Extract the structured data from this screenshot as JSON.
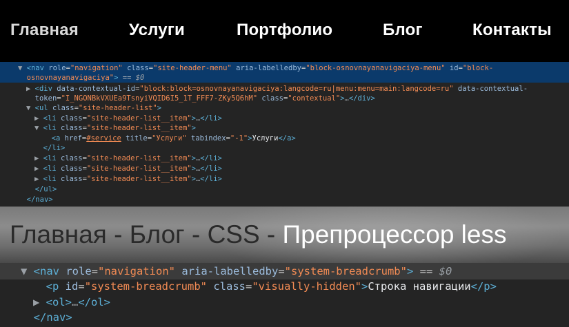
{
  "top_nav": {
    "items": [
      "Главная",
      "Услуги",
      "Портфолио",
      "Блог",
      "Контакты"
    ]
  },
  "devtools_1": {
    "lines": [
      {
        "tri": "▼",
        "parts": [
          [
            "tag",
            "<nav "
          ],
          [
            "attr",
            "role"
          ],
          [
            "eq",
            "="
          ],
          [
            "val",
            "\"navigation\""
          ],
          [
            "attr",
            " class"
          ],
          [
            "eq",
            "="
          ],
          [
            "val",
            "\"site-header-menu\""
          ],
          [
            "attr",
            " aria-labelledby"
          ],
          [
            "eq",
            "="
          ],
          [
            "val",
            "\"block-osnovnayanavigaciya-menu\""
          ],
          [
            "attr",
            " id"
          ],
          [
            "eq",
            "="
          ],
          [
            "val",
            "\"block-"
          ]
        ]
      },
      {
        "tri": "",
        "parts": [
          [
            "val",
            "osnovnayanavigaciya\""
          ],
          [
            "tag",
            ">"
          ],
          [
            "eq",
            " == "
          ],
          [
            "dollar",
            "$0"
          ]
        ]
      },
      {
        "tri": "▶",
        "parts": [
          [
            "tag",
            "<div "
          ],
          [
            "attr",
            "data-contextual-id"
          ],
          [
            "eq",
            "="
          ],
          [
            "val",
            "\"block:block=osnovnayanavigaciya:langcode=ru|menu:menu=main:langcode=ru\""
          ],
          [
            "attr",
            " data-contextual-"
          ]
        ]
      },
      {
        "tri": "",
        "parts": [
          [
            "attr",
            "token"
          ],
          [
            "eq",
            "="
          ],
          [
            "val",
            "\"I_NGONBkVXUEa9TsnyiVQID6I5_1T_FFF7-ZKy5Q6hM\""
          ],
          [
            "attr",
            " class"
          ],
          [
            "eq",
            "="
          ],
          [
            "val",
            "\"contextual\""
          ],
          [
            "tag",
            ">"
          ],
          [
            "dots",
            "…"
          ],
          [
            "tag",
            "</div>"
          ]
        ]
      },
      {
        "tri": "▼",
        "parts": [
          [
            "tag",
            "<ul "
          ],
          [
            "attr",
            "class"
          ],
          [
            "eq",
            "="
          ],
          [
            "val",
            "\"site-header-list\""
          ],
          [
            "tag",
            ">"
          ]
        ]
      },
      {
        "tri": "▶",
        "parts": [
          [
            "tag",
            "<li "
          ],
          [
            "attr",
            "class"
          ],
          [
            "eq",
            "="
          ],
          [
            "val",
            "\"site-header-list__item\""
          ],
          [
            "tag",
            ">"
          ],
          [
            "dots",
            "…"
          ],
          [
            "tag",
            "</li>"
          ]
        ]
      },
      {
        "tri": "▼",
        "parts": [
          [
            "tag",
            "<li "
          ],
          [
            "attr",
            "class"
          ],
          [
            "eq",
            "="
          ],
          [
            "val",
            "\"site-header-list__item\""
          ],
          [
            "tag",
            ">"
          ]
        ]
      },
      {
        "tri": "",
        "parts": [
          [
            "tag",
            "<a "
          ],
          [
            "attr",
            "href"
          ],
          [
            "eq",
            "="
          ],
          [
            "link",
            "#service"
          ],
          [
            "attr",
            " title"
          ],
          [
            "eq",
            "="
          ],
          [
            "val",
            "\"Услуги\""
          ],
          [
            "attr",
            " tabindex"
          ],
          [
            "eq",
            "="
          ],
          [
            "val",
            "\"-1\""
          ],
          [
            "tag",
            ">"
          ],
          [
            "txt",
            "Услуги"
          ],
          [
            "tag",
            "</a>"
          ]
        ]
      },
      {
        "tri": "",
        "parts": [
          [
            "tag",
            "</li>"
          ]
        ]
      },
      {
        "tri": "▶",
        "parts": [
          [
            "tag",
            "<li "
          ],
          [
            "attr",
            "class"
          ],
          [
            "eq",
            "="
          ],
          [
            "val",
            "\"site-header-list__item\""
          ],
          [
            "tag",
            ">"
          ],
          [
            "dots",
            "…"
          ],
          [
            "tag",
            "</li>"
          ]
        ]
      },
      {
        "tri": "▶",
        "parts": [
          [
            "tag",
            "<li "
          ],
          [
            "attr",
            "class"
          ],
          [
            "eq",
            "="
          ],
          [
            "val",
            "\"site-header-list__item\""
          ],
          [
            "tag",
            ">"
          ],
          [
            "dots",
            "…"
          ],
          [
            "tag",
            "</li>"
          ]
        ]
      },
      {
        "tri": "▶",
        "parts": [
          [
            "tag",
            "<li "
          ],
          [
            "attr",
            "class"
          ],
          [
            "eq",
            "="
          ],
          [
            "val",
            "\"site-header-list__item\""
          ],
          [
            "tag",
            ">"
          ],
          [
            "dots",
            "…"
          ],
          [
            "tag",
            "</li>"
          ]
        ]
      },
      {
        "tri": "",
        "parts": [
          [
            "tag",
            "</ul>"
          ]
        ]
      },
      {
        "tri": "",
        "parts": [
          [
            "tag",
            "</nav>"
          ]
        ]
      }
    ]
  },
  "breadcrumb_band": {
    "items": [
      "Главная",
      "Блог",
      "CSS"
    ],
    "separator": " - ",
    "current": "Препроцессор less"
  },
  "devtools_2": {
    "lines": [
      {
        "tri": "▼",
        "parts": [
          [
            "tag",
            "<nav "
          ],
          [
            "attr",
            "role"
          ],
          [
            "eq",
            "="
          ],
          [
            "val",
            "\"navigation\""
          ],
          [
            "attr",
            " aria-labelledby"
          ],
          [
            "eq",
            "="
          ],
          [
            "val",
            "\"system-breadcrumb\""
          ],
          [
            "tag",
            ">"
          ],
          [
            "eq",
            " == "
          ],
          [
            "dollar",
            "$0"
          ]
        ]
      },
      {
        "tri": "",
        "parts": [
          [
            "tag",
            "<p "
          ],
          [
            "attr",
            "id"
          ],
          [
            "eq",
            "="
          ],
          [
            "val",
            "\"system-breadcrumb\""
          ],
          [
            "attr",
            " class"
          ],
          [
            "eq",
            "="
          ],
          [
            "val",
            "\"visually-hidden\""
          ],
          [
            "tag",
            ">"
          ],
          [
            "txt",
            "Строка навигации"
          ],
          [
            "tag",
            "</p>"
          ]
        ]
      },
      {
        "tri": "▶",
        "parts": [
          [
            "tag",
            "<ol>"
          ],
          [
            "dots",
            "…"
          ],
          [
            "tag",
            "</ol>"
          ]
        ]
      },
      {
        "tri": "",
        "parts": [
          [
            "tag",
            "</nav>"
          ]
        ]
      }
    ]
  }
}
